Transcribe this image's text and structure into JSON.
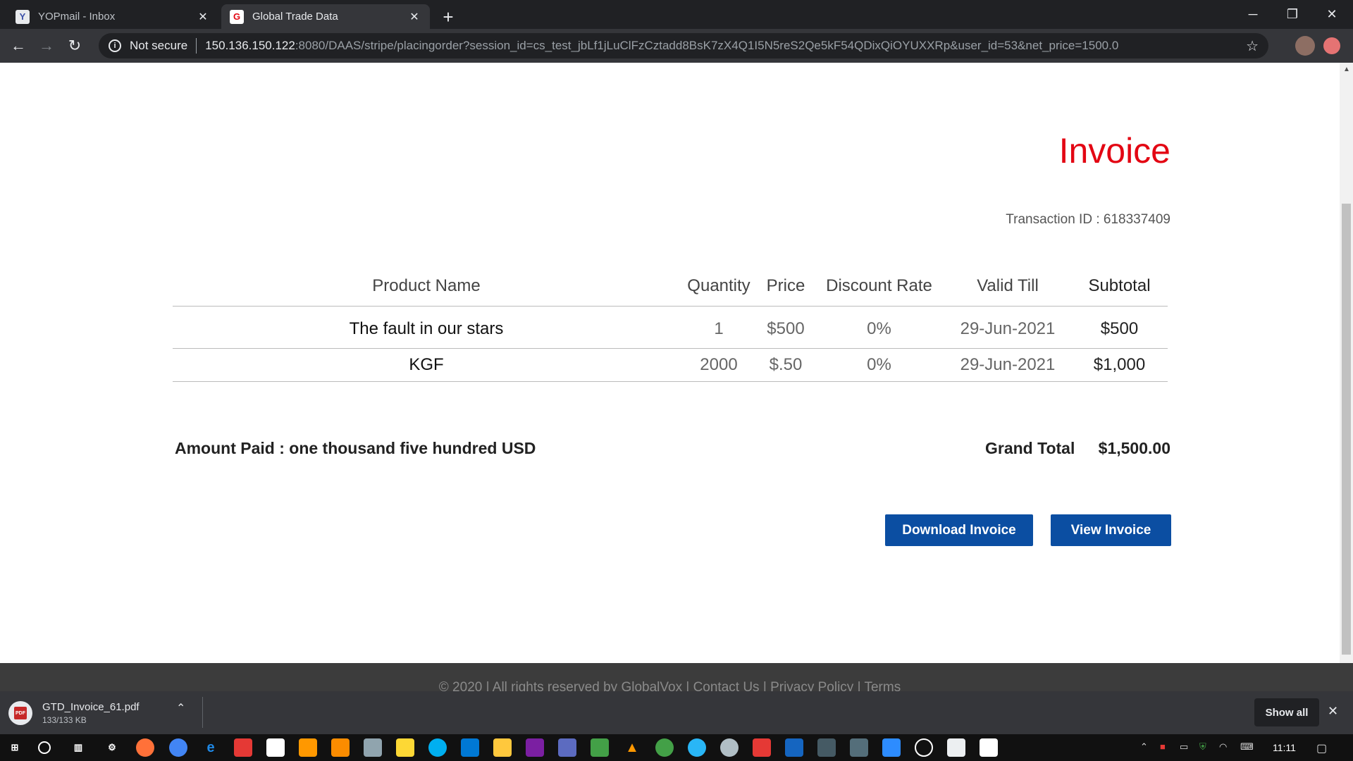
{
  "browser": {
    "tabs": [
      {
        "title": "YOPmail - Inbox",
        "favicon": "yopmail-icon",
        "active": false
      },
      {
        "title": "Global Trade Data",
        "favicon": "gtd-icon",
        "active": true
      }
    ],
    "address_bar": {
      "security_label": "Not secure",
      "host": "150.136.150.122",
      "path": ":8080/DAAS/stripe/placingorder?session_id=cs_test_jbLf1jLuClFzCztadd8BsK7zX4Q1I5N5reS2Qe5kF54QDixQiOYUXXRp&user_id=53&net_price=1500.0"
    }
  },
  "invoice": {
    "title": "Invoice",
    "transaction_label": "Transaction ID : 618337409",
    "columns": [
      "Product Name",
      "Quantity",
      "Price",
      "Discount Rate",
      "Valid Till",
      "Subtotal"
    ],
    "rows": [
      [
        "The fault in our stars",
        "1",
        "$500",
        "0%",
        "29-Jun-2021",
        "$500"
      ],
      [
        "KGF",
        "2000",
        "$.50",
        "0%",
        "29-Jun-2021",
        "$1,000"
      ]
    ],
    "amount_paid": "Amount Paid : one thousand five hundred USD",
    "grand_total_label": "Grand Total",
    "grand_total_value": "$1,500.00",
    "download_button": "Download Invoice",
    "view_button": "View Invoice"
  },
  "footer": {
    "copyright": "© 2020 | All rights reserved by GlobalVox",
    "links": [
      "Contact Us",
      "Privacy Policy",
      "Terms"
    ]
  },
  "download_shelf": {
    "file_name": "GTD_Invoice_61.pdf",
    "file_size": "133/133 KB",
    "show_all": "Show all"
  },
  "taskbar": {
    "clock": "11:11"
  },
  "colors": {
    "invoice_title": "#e30613",
    "button_bg": "#0b4ea2",
    "chrome_dark": "#202124",
    "chrome_toolbar": "#35363a"
  }
}
